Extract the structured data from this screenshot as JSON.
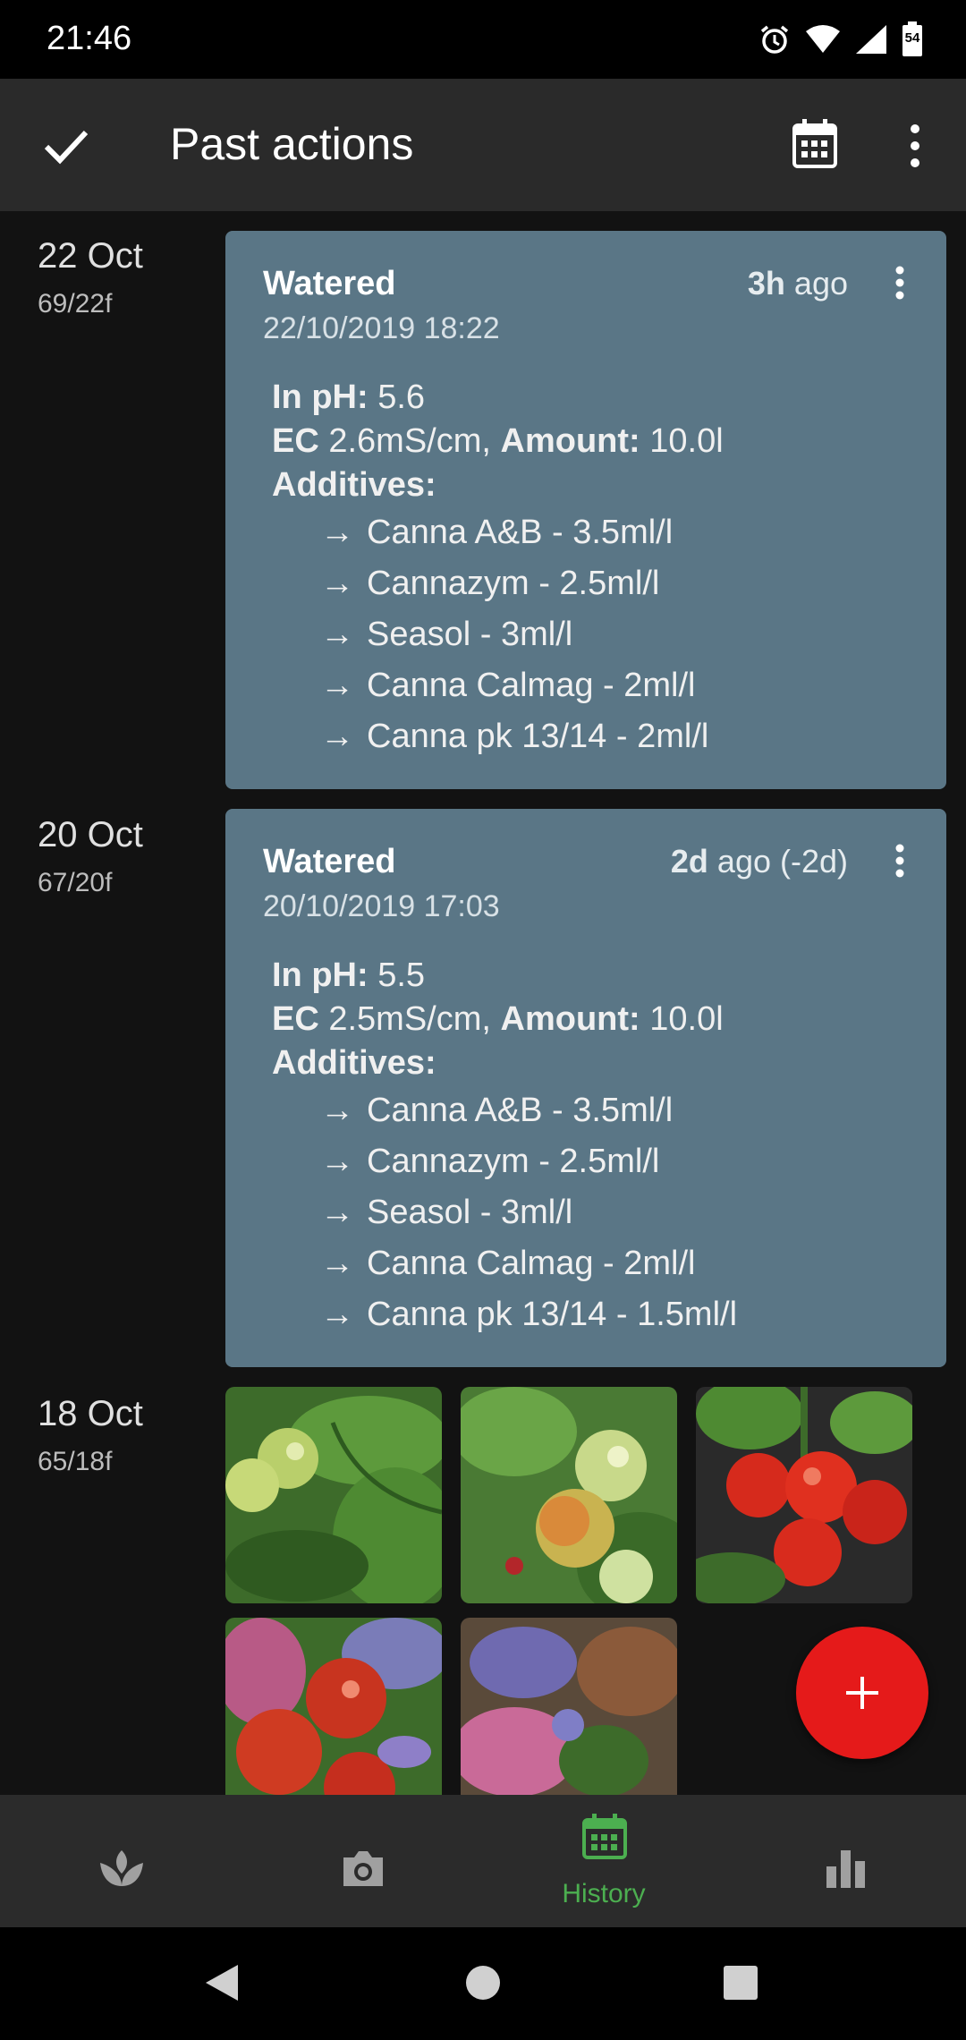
{
  "status_bar": {
    "time": "21:46",
    "battery": "54",
    "icons": [
      "alarm-icon",
      "wifi-icon",
      "signal-icon",
      "battery-icon"
    ]
  },
  "app_bar": {
    "title": "Past actions",
    "icons": [
      "check-icon",
      "calendar-icon",
      "more-vert-icon"
    ]
  },
  "history": [
    {
      "date": "22 Oct",
      "temp": "69/22f",
      "card": {
        "title": "Watered",
        "ago_bold": "3h",
        "ago_rest": " ago",
        "timestamp": "22/10/2019 18:22",
        "ph_label": "In pH:",
        "ph_value": " 5.6",
        "ec_label": "EC",
        "ec_value": " 2.6mS/cm, ",
        "amount_label": "Amount:",
        "amount_value": " 10.0l",
        "additives_label": "Additives:",
        "additives": [
          "Canna A&B - 3.5ml/l",
          "Cannazym - 2.5ml/l",
          "Seasol - 3ml/l",
          "Canna Calmag - 2ml/l",
          "Canna pk 13/14 - 2ml/l"
        ]
      }
    },
    {
      "date": "20 Oct",
      "temp": "67/20f",
      "card": {
        "title": "Watered",
        "ago_bold": "2d",
        "ago_rest": " ago (-2d)",
        "timestamp": "20/10/2019 17:03",
        "ph_label": "In pH:",
        "ph_value": " 5.5",
        "ec_label": "EC",
        "ec_value": " 2.5mS/cm, ",
        "amount_label": "Amount:",
        "amount_value": " 10.0l",
        "additives_label": "Additives:",
        "additives": [
          "Canna A&B - 3.5ml/l",
          "Cannazym - 2.5ml/l",
          "Seasol - 3ml/l",
          "Canna Calmag - 2ml/l",
          "Canna pk 13/14 - 1.5ml/l"
        ]
      }
    },
    {
      "date": "18 Oct",
      "temp": "65/18f",
      "photos": [
        "green-tomatoes-photo",
        "ripening-tomatoes-photo",
        "red-tomatoes-photo",
        "tomato-flowers-photo",
        "flowers-photo"
      ]
    }
  ],
  "additive_arrow": "→",
  "fab": {
    "icon": "plus-icon",
    "label": "+"
  },
  "bottom_nav": {
    "items": [
      {
        "icon": "plant-icon",
        "label": ""
      },
      {
        "icon": "camera-icon",
        "label": ""
      },
      {
        "icon": "calendar-icon",
        "label": "History",
        "active": true
      },
      {
        "icon": "bar-chart-icon",
        "label": ""
      }
    ],
    "active_color": "#4caf50",
    "inactive_color": "#a0a0a0"
  },
  "colors": {
    "card_bg": "#5a7686",
    "app_bar_bg": "#2a2a2a",
    "fab_bg": "#e51a1a",
    "background": "#121212"
  }
}
